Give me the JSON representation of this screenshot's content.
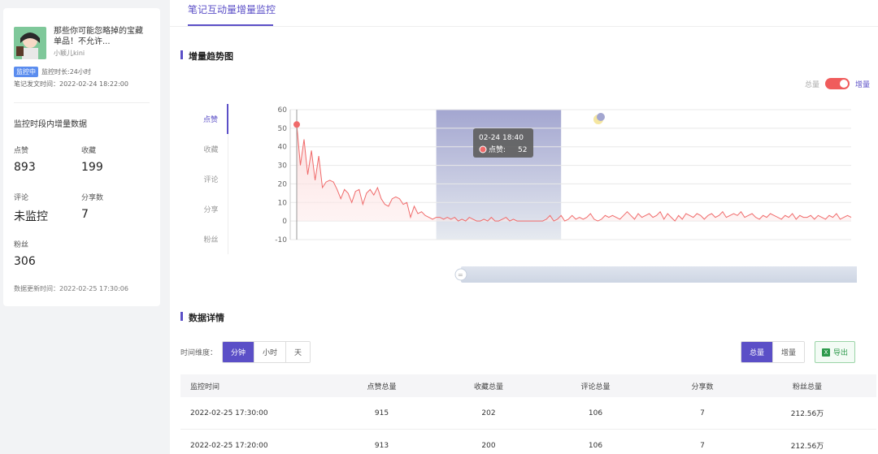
{
  "note": {
    "title": "那些你可能忽略掉的宝藏单品！不允许...",
    "author": "小颖儿kini",
    "badge": "监控中",
    "duration": "监控时长:24小时",
    "post_time": "笔记发文时间：2022-02-24 18:22:00"
  },
  "stats": {
    "heading": "监控时段内增量数据",
    "like_label": "点赞",
    "like_value": "893",
    "collect_label": "收藏",
    "collect_value": "199",
    "comment_label": "评论",
    "comment_value": "未监控",
    "share_label": "分享数",
    "share_value": "7",
    "fans_label": "粉丝",
    "fans_value": "306",
    "update_time": "数据更新时间：2022-02-25 17:30:06"
  },
  "main": {
    "tab": "笔记互动量增量监控",
    "trend_title": "增量趋势图",
    "toggle_total": "总量",
    "toggle_increment": "增量",
    "metric_tabs": [
      "点赞",
      "收藏",
      "评论",
      "分享",
      "粉丝"
    ],
    "tooltip_time": "02-24 18:40",
    "tooltip_label": "点赞:",
    "tooltip_value": "52",
    "detail_title": "数据详情",
    "dimension_label": "时间维度：",
    "dimensions": [
      "分钟",
      "小时",
      "天"
    ],
    "view_total": "总量",
    "view_increment": "增量",
    "export": "导出"
  },
  "chart_data": {
    "type": "line",
    "ylim": [
      -10,
      60
    ],
    "yticks": [
      "60",
      "50",
      "40",
      "30",
      "20",
      "10",
      "0",
      "-10"
    ],
    "series": [
      {
        "values": [
          52,
          30,
          44,
          25,
          38,
          22,
          35,
          18,
          21,
          22,
          21,
          17,
          12,
          17,
          15,
          10,
          16,
          17,
          9,
          15,
          17,
          14,
          18,
          12,
          9,
          8,
          12,
          13,
          12,
          9,
          10,
          2,
          8,
          4,
          5,
          3,
          2,
          1,
          2,
          2,
          1,
          2,
          1,
          2,
          0,
          1,
          0,
          2,
          1,
          0,
          0,
          1,
          0,
          2,
          0,
          0,
          1,
          2,
          0,
          1,
          0,
          0,
          0,
          0,
          0,
          0,
          0,
          0,
          1,
          3,
          0,
          1,
          3,
          0,
          1,
          3,
          1,
          2,
          1,
          2,
          4,
          1,
          0,
          1,
          3,
          2,
          3,
          2,
          1,
          3,
          5,
          3,
          1,
          4,
          2,
          3,
          4,
          2,
          3,
          5,
          1,
          4,
          2,
          0,
          3,
          1,
          4,
          3,
          2,
          4,
          3,
          1,
          3,
          4,
          2,
          3,
          5,
          2,
          3,
          4,
          3,
          5,
          2,
          3,
          4,
          2,
          1,
          3,
          2,
          4,
          3,
          2,
          1,
          3,
          2,
          4,
          1,
          3,
          2,
          2,
          3,
          1,
          3,
          2,
          1,
          3,
          2,
          4,
          1,
          2,
          3,
          2
        ]
      }
    ],
    "night_band": {
      "start_index": 38,
      "end_index": 72
    },
    "color": "#f06a6a"
  },
  "table": {
    "headers": [
      "监控时间",
      "点赞总量",
      "收藏总量",
      "评论总量",
      "分享数",
      "粉丝总量"
    ],
    "rows": [
      [
        "2022-02-25 17:30:00",
        "915",
        "202",
        "106",
        "7",
        "212.56万"
      ],
      [
        "2022-02-25 17:20:00",
        "913",
        "200",
        "106",
        "7",
        "212.56万"
      ]
    ]
  }
}
